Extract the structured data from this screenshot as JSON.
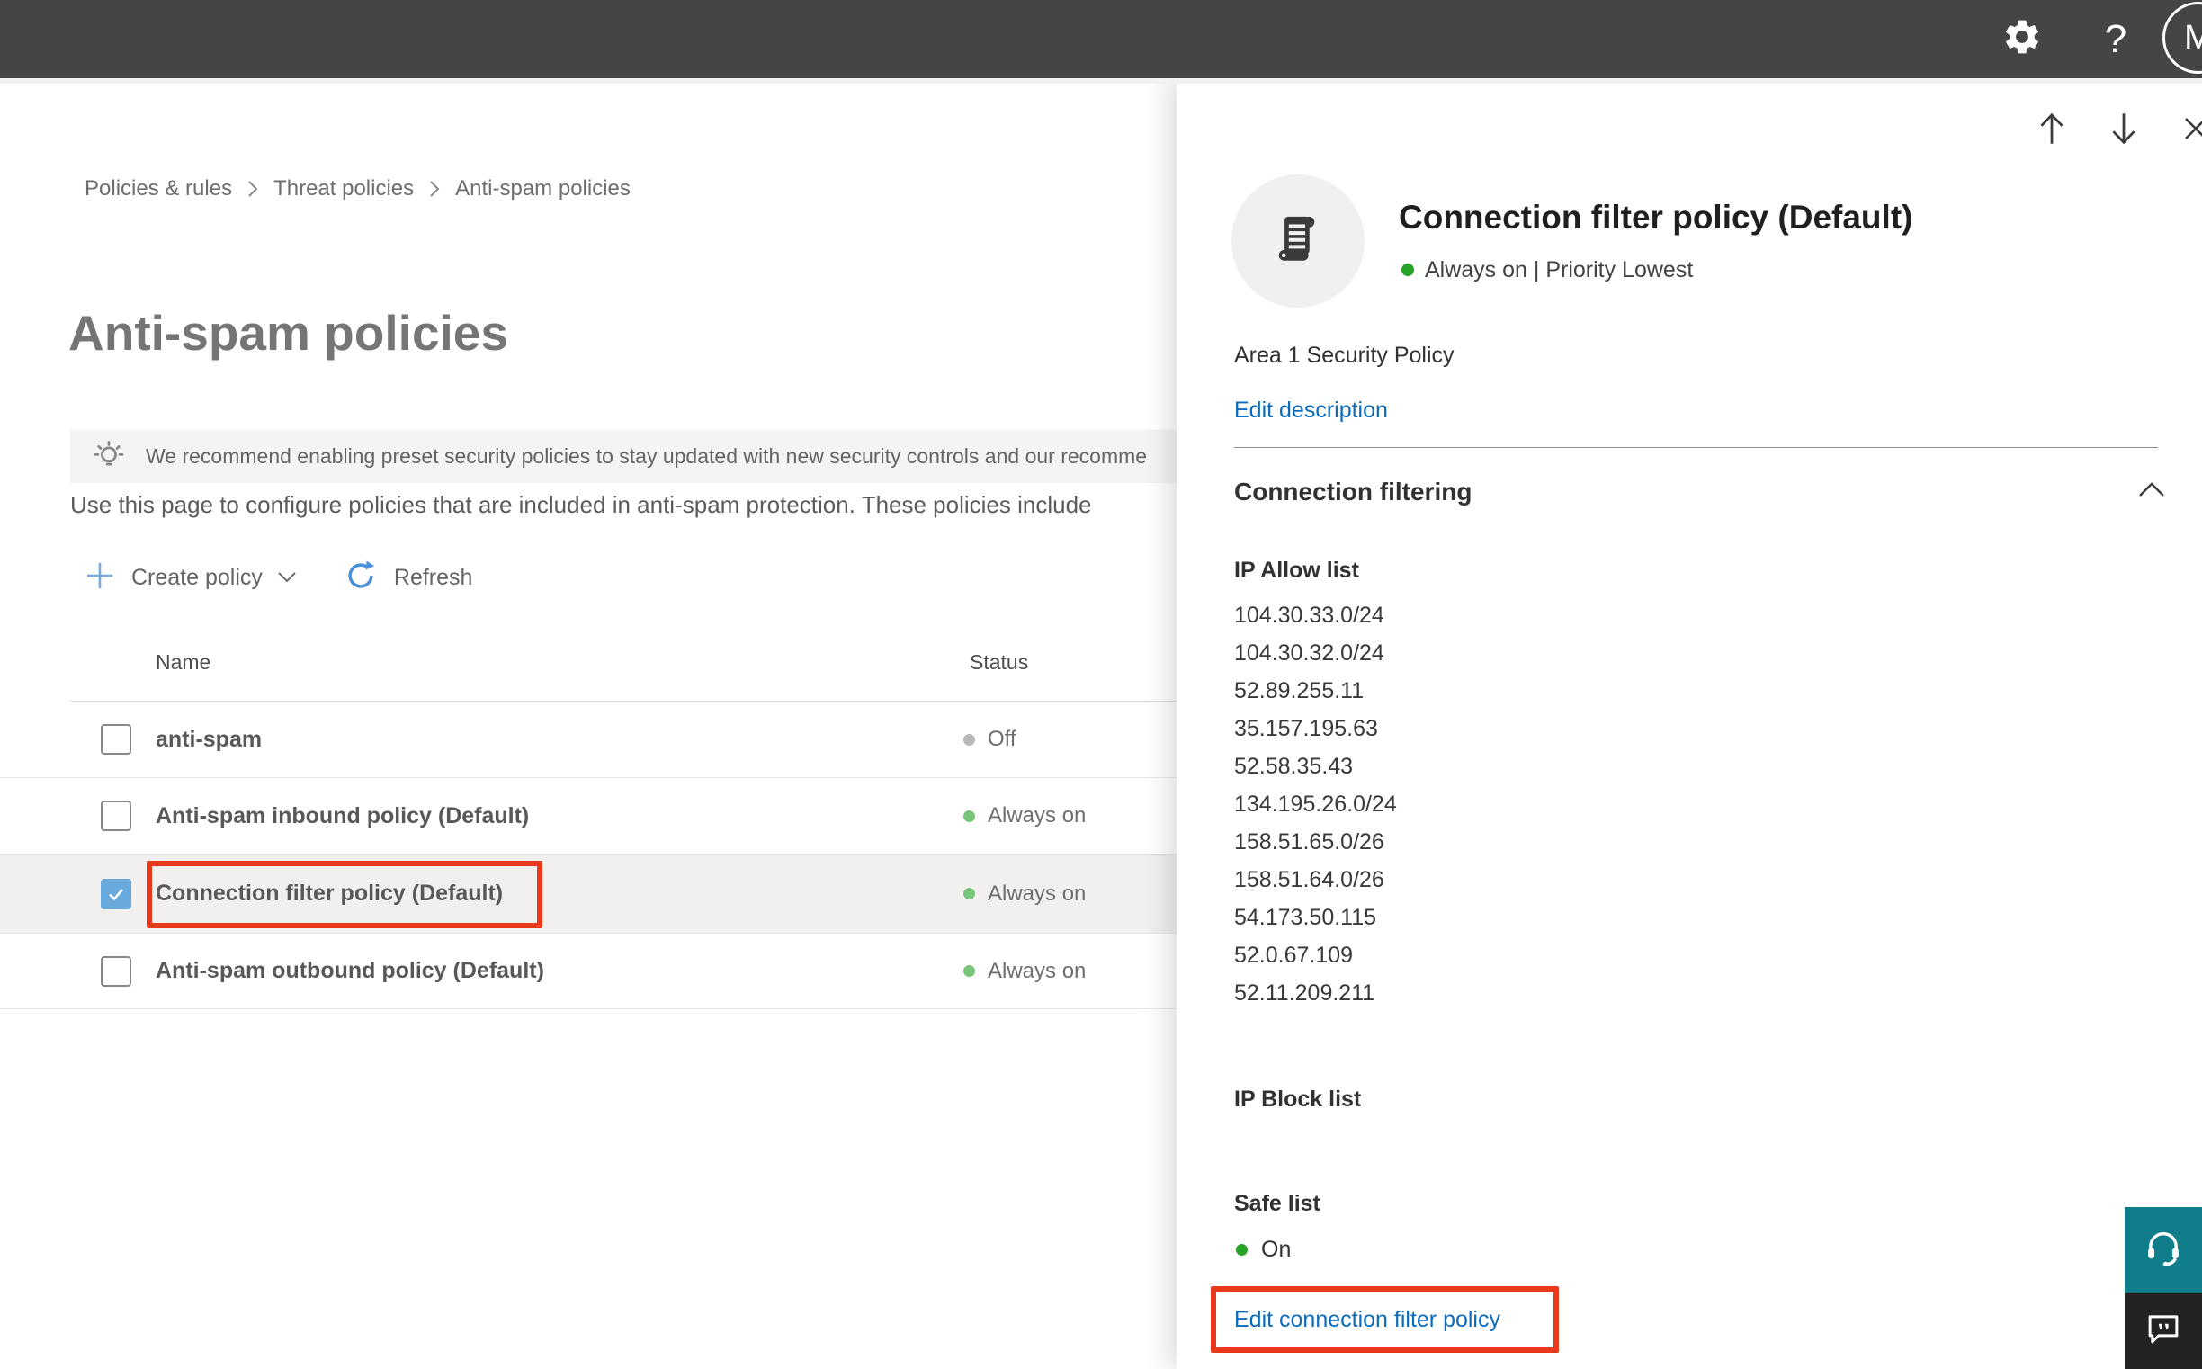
{
  "topbar": {
    "help_label": "?",
    "avatar_initial": "M"
  },
  "breadcrumb": {
    "items": [
      "Policies & rules",
      "Threat policies",
      "Anti-spam policies"
    ]
  },
  "page": {
    "title": "Anti-spam policies",
    "banner_text": "We recommend enabling preset security policies to stay updated with new security controls and our recomme",
    "intro_text": "Use this page to configure policies that are included in anti-spam protection. These policies include"
  },
  "toolbar": {
    "create_policy_label": "Create policy",
    "refresh_label": "Refresh"
  },
  "table": {
    "columns": [
      "Name",
      "Status"
    ],
    "rows": [
      {
        "name": "anti-spam",
        "status": "Off",
        "checked": false,
        "selected": false
      },
      {
        "name": "Anti-spam inbound policy (Default)",
        "status": "Always on",
        "checked": false,
        "selected": false
      },
      {
        "name": "Connection filter policy (Default)",
        "status": "Always on",
        "checked": true,
        "selected": true
      },
      {
        "name": "Anti-spam outbound policy (Default)",
        "status": "Always on",
        "checked": false,
        "selected": false
      }
    ]
  },
  "panel": {
    "title": "Connection filter policy (Default)",
    "status_line": "Always on | Priority Lowest",
    "description": "Area 1 Security Policy",
    "edit_description_label": "Edit description",
    "section_heading": "Connection filtering",
    "ip_allow_heading": "IP Allow list",
    "ip_allow_list": [
      "104.30.33.0/24",
      "104.30.32.0/24",
      "52.89.255.11",
      "35.157.195.63",
      "52.58.35.43",
      "134.195.26.0/24",
      "158.51.65.0/26",
      "158.51.64.0/26",
      "54.173.50.115",
      "52.0.67.109",
      "52.11.209.211"
    ],
    "ip_block_heading": "IP Block list",
    "safe_list_heading": "Safe list",
    "safe_list_status": "On",
    "edit_policy_label": "Edit connection filter policy"
  },
  "colors": {
    "annotation_red": "#E8391D",
    "checkbox_blue": "#68A9DE",
    "table_status_green": "#77C677",
    "table_status_gray": "#B8B8B8",
    "panel_status_green": "#27A327",
    "link_blue": "#0B6CBD",
    "topbar_bg": "#464543",
    "support_teal": "#0F7E8A",
    "feedback_dark": "#252321"
  }
}
